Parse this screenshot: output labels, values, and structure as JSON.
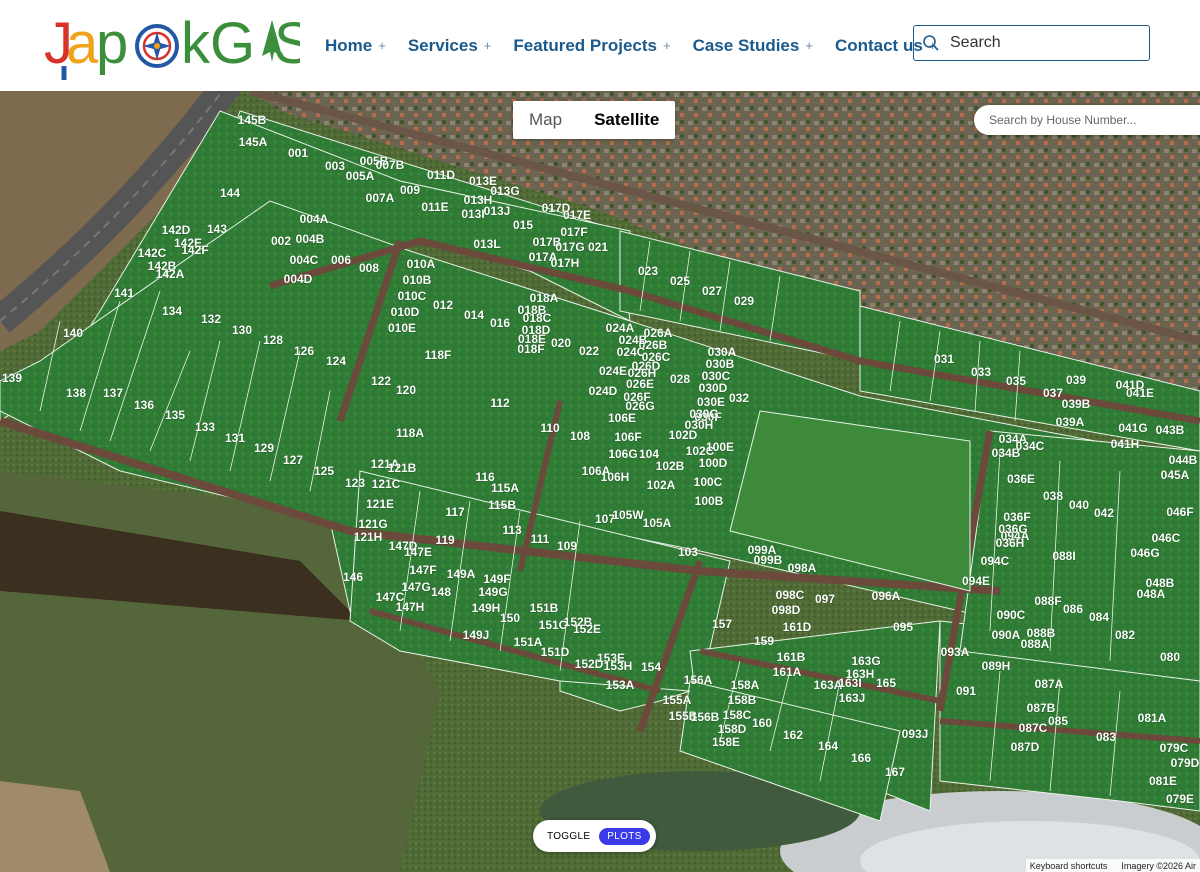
{
  "brand": {
    "logo_text": "JapakGIS",
    "logo_alt": "JapakGIS logo"
  },
  "nav": {
    "items": [
      {
        "label": "Home",
        "expand": "+"
      },
      {
        "label": "Services",
        "expand": "+"
      },
      {
        "label": "Featured Projects",
        "expand": "+"
      },
      {
        "label": "Case Studies",
        "expand": "+"
      },
      {
        "label": "Contact us",
        "expand": "+"
      }
    ]
  },
  "search": {
    "placeholder": "Search",
    "icon": "search-icon"
  },
  "map": {
    "type_controls": {
      "map_label": "Map",
      "satellite_label": "Satellite",
      "active": "Satellite"
    },
    "house_search": {
      "placeholder": "Search by House Number..."
    },
    "toggle": {
      "label": "TOGGLE",
      "pill": "PLOTS"
    },
    "attribution": {
      "shortcuts": "Keyboard shortcuts",
      "imagery": "Imagery ©2026 Air"
    },
    "plot_labels": [
      "145B",
      "145A",
      "001",
      "003",
      "005B",
      "005A",
      "007B",
      "007A",
      "009",
      "011D",
      "011E",
      "013E",
      "013G",
      "013H",
      "013I",
      "013J",
      "013L",
      "015",
      "017D",
      "017E",
      "017F",
      "017B",
      "017A",
      "017G",
      "017H",
      "021",
      "144",
      "142D",
      "142E",
      "142F",
      "142C",
      "142B",
      "142A",
      "143",
      "141",
      "140",
      "139",
      "138",
      "137",
      "136",
      "135",
      "134",
      "133",
      "132",
      "131",
      "130",
      "129",
      "128",
      "127",
      "126",
      "125",
      "124",
      "123",
      "122",
      "121A",
      "121B",
      "121C",
      "121E",
      "121G",
      "121H",
      "120",
      "119",
      "118F",
      "118A",
      "117",
      "116",
      "115A",
      "115B",
      "113",
      "112",
      "111",
      "110",
      "109",
      "108",
      "107",
      "106H",
      "106E",
      "106F",
      "106G",
      "106A",
      "105W",
      "105A",
      "104",
      "103",
      "102D",
      "102B",
      "102A",
      "102C",
      "100E",
      "100D",
      "100C",
      "100B",
      "099A",
      "099B",
      "098A",
      "098C",
      "098D",
      "097",
      "096A",
      "095",
      "094A",
      "094C",
      "094E",
      "093A",
      "093J",
      "091",
      "090A",
      "090C",
      "089H",
      "088A",
      "088B",
      "088F",
      "088I",
      "087A",
      "087B",
      "087C",
      "087D",
      "086",
      "085",
      "084",
      "083",
      "082",
      "081A",
      "081E",
      "080",
      "079C",
      "079D",
      "079E",
      "046F",
      "046C",
      "046G",
      "048A",
      "048B",
      "045A",
      "044B",
      "043B",
      "042",
      "041E",
      "041G",
      "041H",
      "041D",
      "040",
      "039",
      "039A",
      "039B",
      "038",
      "037",
      "036E",
      "036F",
      "036G",
      "036H",
      "035",
      "034A",
      "034B",
      "034C",
      "033",
      "032",
      "031",
      "030A",
      "030B",
      "030C",
      "030D",
      "030E",
      "030F",
      "030G",
      "030H",
      "029",
      "028",
      "027",
      "026A",
      "026B",
      "026C",
      "026D",
      "026E",
      "026F",
      "026G",
      "026H",
      "025",
      "024A",
      "024B",
      "024C",
      "024E",
      "024D",
      "023",
      "022",
      "020",
      "018A",
      "018B",
      "018C",
      "018D",
      "018E",
      "018F",
      "016",
      "014",
      "012",
      "010A",
      "010B",
      "010C",
      "010D",
      "010E",
      "008",
      "006",
      "004A",
      "004B",
      "004C",
      "004D",
      "002",
      "146",
      "147D",
      "147E",
      "147F",
      "147G",
      "147H",
      "147C",
      "148",
      "149A",
      "149F",
      "149G",
      "149H",
      "149J",
      "150",
      "151A",
      "151B",
      "151C",
      "151D",
      "152D",
      "152B",
      "152E",
      "153E",
      "153A",
      "153H",
      "154",
      "155A",
      "155B",
      "156A",
      "156B",
      "157",
      "158A",
      "158B",
      "158C",
      "158D",
      "158E",
      "159",
      "160",
      "161A",
      "161B",
      "161D",
      "162",
      "163A",
      "163G",
      "163H",
      "163I",
      "163J",
      "164",
      "165",
      "166",
      "167"
    ]
  }
}
